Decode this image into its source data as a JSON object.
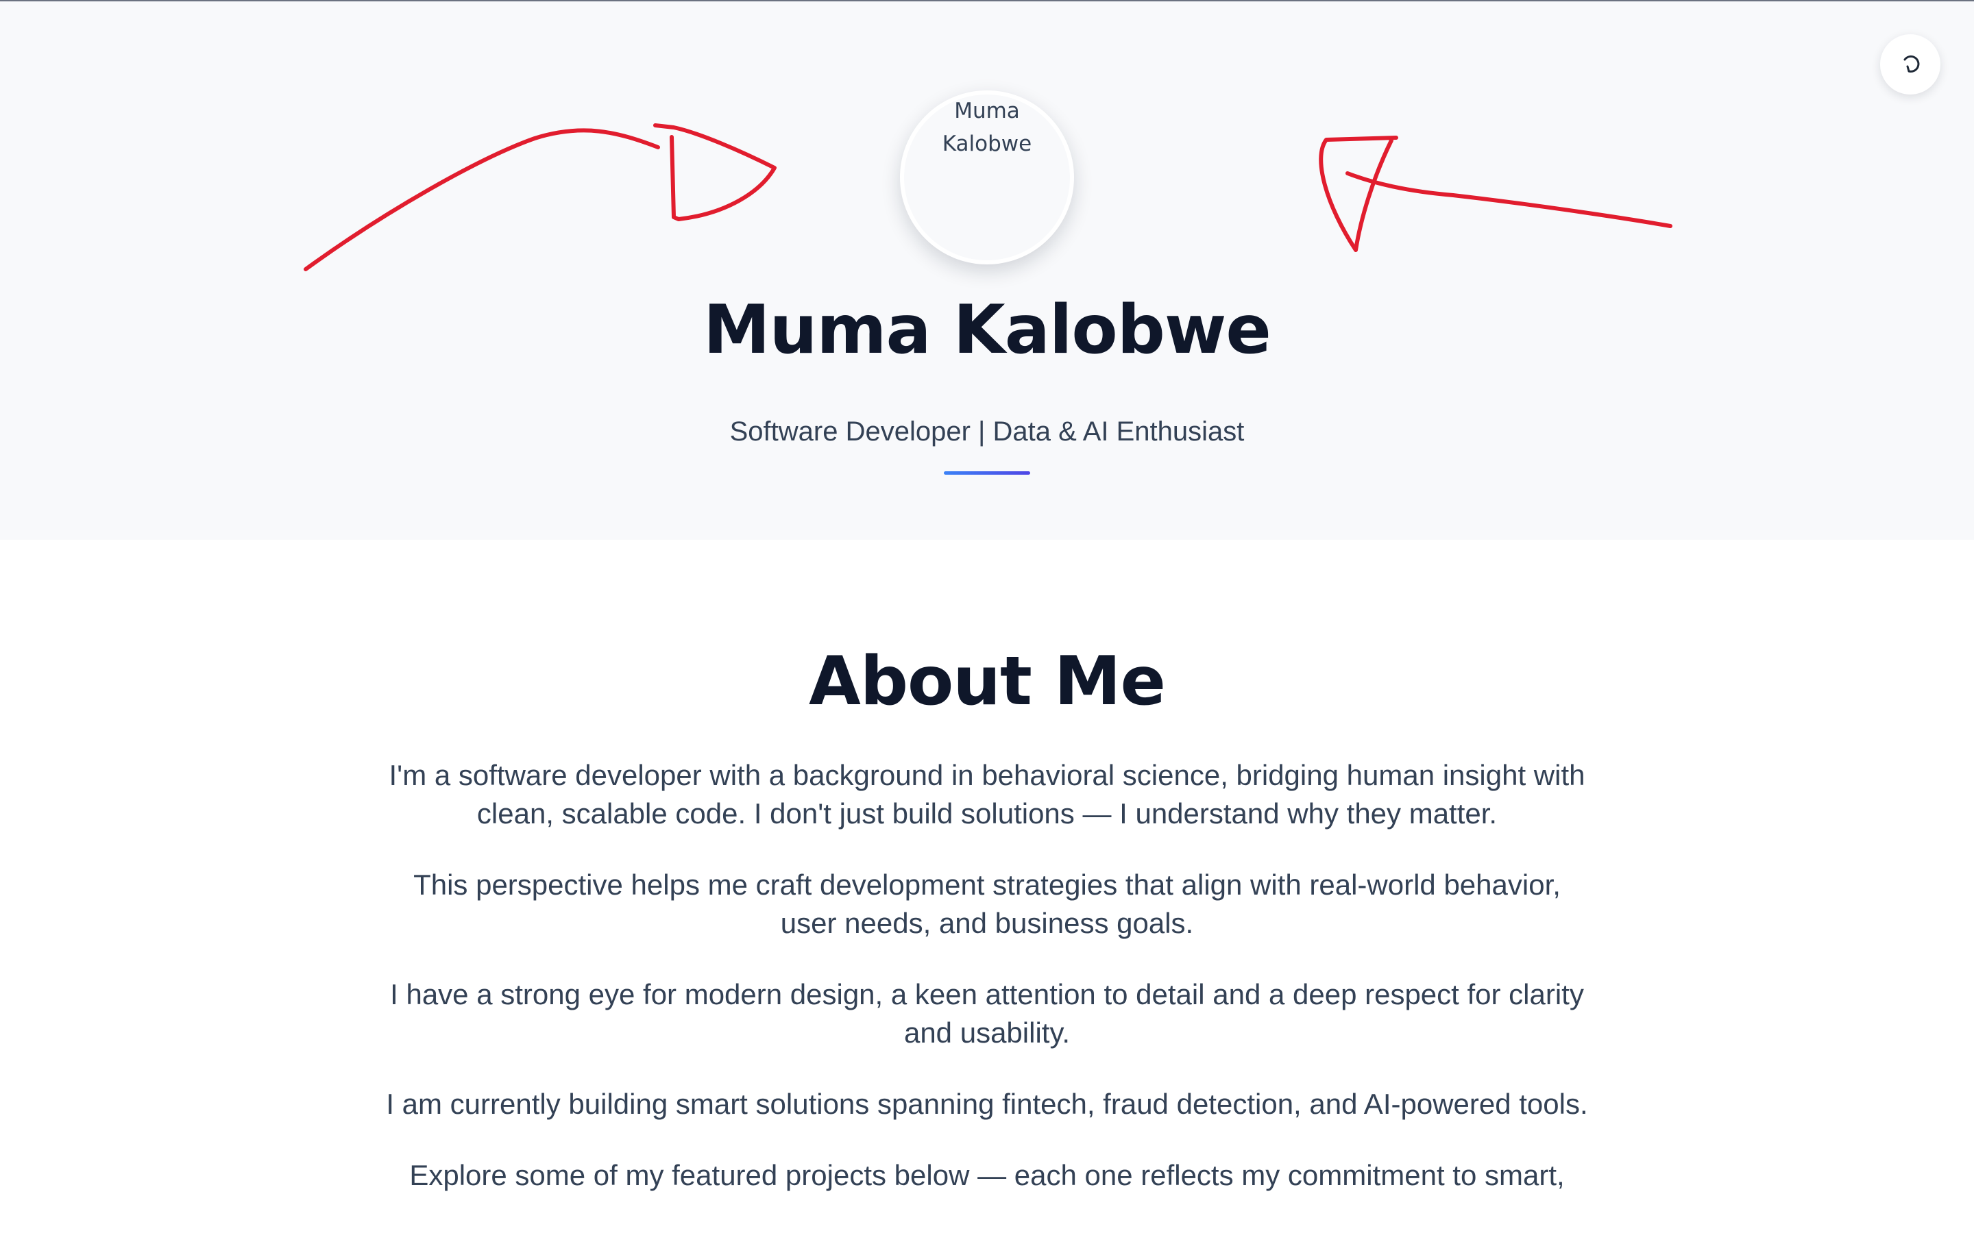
{
  "hero": {
    "avatar_alt": "Muma Kalobwe",
    "name": "Muma Kalobwe",
    "subtitle": "Software Developer | Data & AI Enthusiast"
  },
  "theme_toggle": {
    "icon": "refresh-icon"
  },
  "about": {
    "title": "About Me",
    "paragraphs": [
      "I'm a software developer with a background in behavioral science, bridging human insight with clean, scalable code. I don't just build solutions — I understand why they matter.",
      "This perspective helps me craft development strategies that align with real-world behavior, user needs, and business goals.",
      "I have a strong eye for modern design, a keen attention to detail and a deep respect for clarity and usability.",
      "I am currently building smart solutions spanning fintech, fraud detection, and AI-powered tools.",
      "Explore some of my featured projects below — each one reflects my commitment to smart,"
    ]
  },
  "colors": {
    "hero_bg": "#f8f9fb",
    "heading": "#0f172a",
    "body_text": "#334155",
    "accent_start": "#3b82f6",
    "accent_end": "#4f46e5",
    "annotation_red": "#e11d2e"
  }
}
